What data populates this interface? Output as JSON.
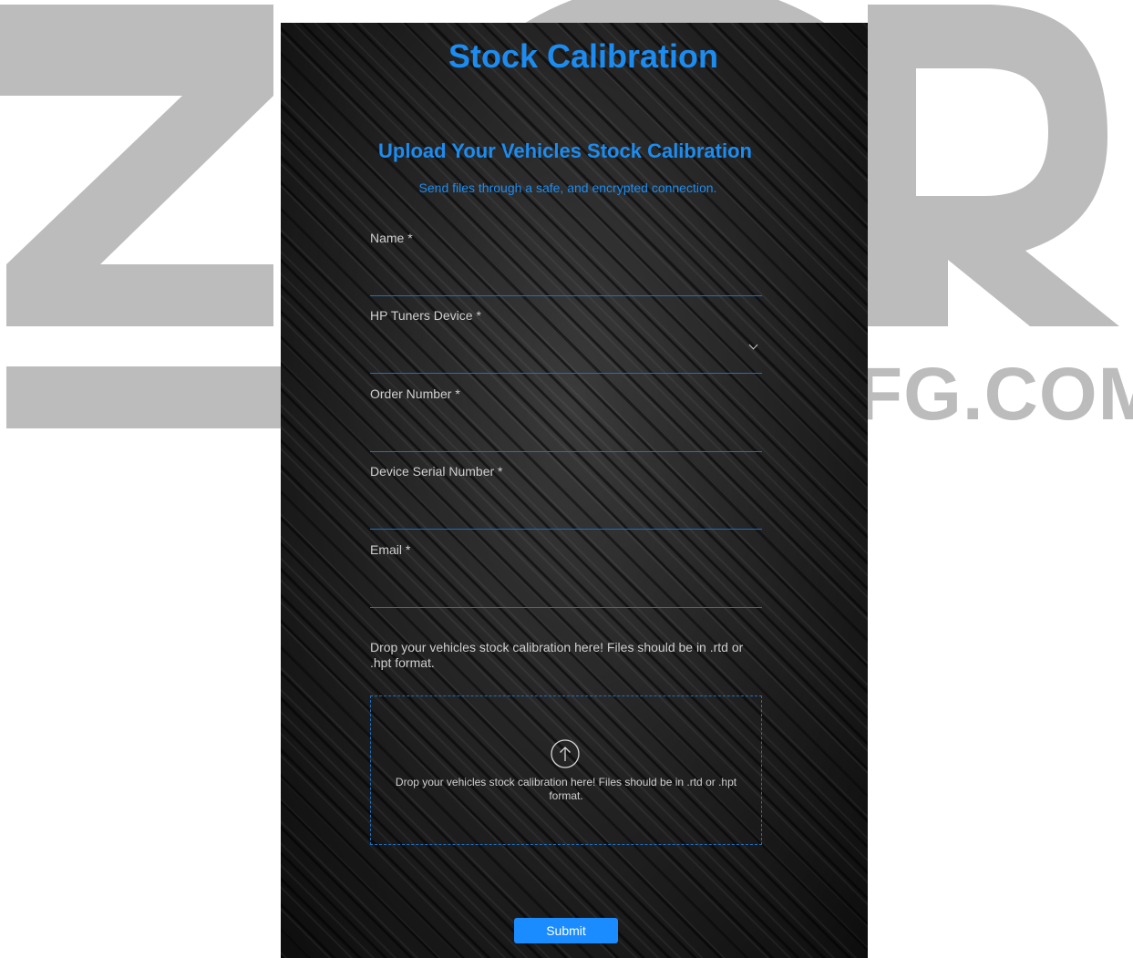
{
  "background": {
    "brand_text": "FG.COM",
    "logo_color": "#bcbcbc"
  },
  "form": {
    "title": "Stock Calibration",
    "subtitle": "Upload Your Vehicles Stock Calibration",
    "tagline": "Send files through a safe, and encrypted connection.",
    "fields": {
      "name": {
        "label": "Name *",
        "value": ""
      },
      "device": {
        "label": "HP Tuners Device *",
        "value": ""
      },
      "order": {
        "label": "Order Number *",
        "value": ""
      },
      "serial": {
        "label": "Device Serial Number *",
        "value": ""
      },
      "email": {
        "label": "Email *",
        "value": ""
      }
    },
    "upload_note": "Drop your vehicles stock calibration here! Files should be in .rtd or .hpt format.",
    "dropzone_text": "Drop your vehicles stock calibration here! Files should be in .rtd or .hpt format.",
    "submit_label": "Submit"
  },
  "colors": {
    "accent": "#1d8cf0",
    "button": "#1a8cff",
    "panel": "#1b1b1b"
  },
  "icons": {
    "upload": "arrow-up-circle-icon",
    "select": "chevron-down-icon"
  }
}
